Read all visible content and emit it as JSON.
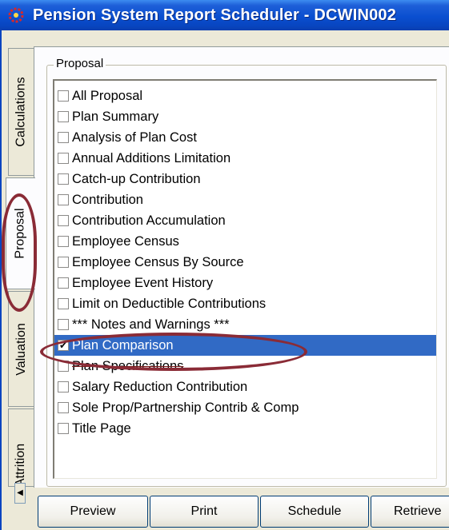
{
  "window": {
    "title": "Pension System Report Scheduler - DCWIN002"
  },
  "tabs": [
    {
      "label": "Calculations",
      "active": false
    },
    {
      "label": "Proposal",
      "active": true
    },
    {
      "label": "Valuation",
      "active": false
    },
    {
      "label": "Attrition",
      "active": false
    }
  ],
  "group": {
    "label": "Proposal"
  },
  "reports": [
    {
      "label": "All Proposal",
      "checked": false
    },
    {
      "label": "Plan Summary",
      "checked": false
    },
    {
      "label": "Analysis of Plan Cost",
      "checked": false
    },
    {
      "label": "Annual Additions Limitation",
      "checked": false
    },
    {
      "label": "Catch-up Contribution",
      "checked": false
    },
    {
      "label": "Contribution",
      "checked": false
    },
    {
      "label": "Contribution Accumulation",
      "checked": false
    },
    {
      "label": "Employee Census",
      "checked": false
    },
    {
      "label": "Employee Census By Source",
      "checked": false
    },
    {
      "label": "Employee Event History",
      "checked": false
    },
    {
      "label": "Limit on Deductible Contributions",
      "checked": false
    },
    {
      "label": "*** Notes and Warnings ***",
      "checked": false
    },
    {
      "label": "Plan Comparison",
      "checked": true,
      "selected": true
    },
    {
      "label": "Plan Specifications",
      "checked": false
    },
    {
      "label": "Salary Reduction Contribution",
      "checked": false
    },
    {
      "label": "Sole Prop/Partnership Contrib & Comp",
      "checked": false
    },
    {
      "label": "Title Page",
      "checked": false
    }
  ],
  "buttons": {
    "preview": "Preview",
    "print": "Print",
    "schedule": "Schedule",
    "retrieve": "Retrieve"
  },
  "colors": {
    "titlebar": "#0a4fd0",
    "selection": "#316ac5",
    "annotation": "#8a2b36"
  },
  "icons": {
    "app": "app-icon",
    "check": "check-icon",
    "scroll": "scroll-arrow-icon"
  }
}
